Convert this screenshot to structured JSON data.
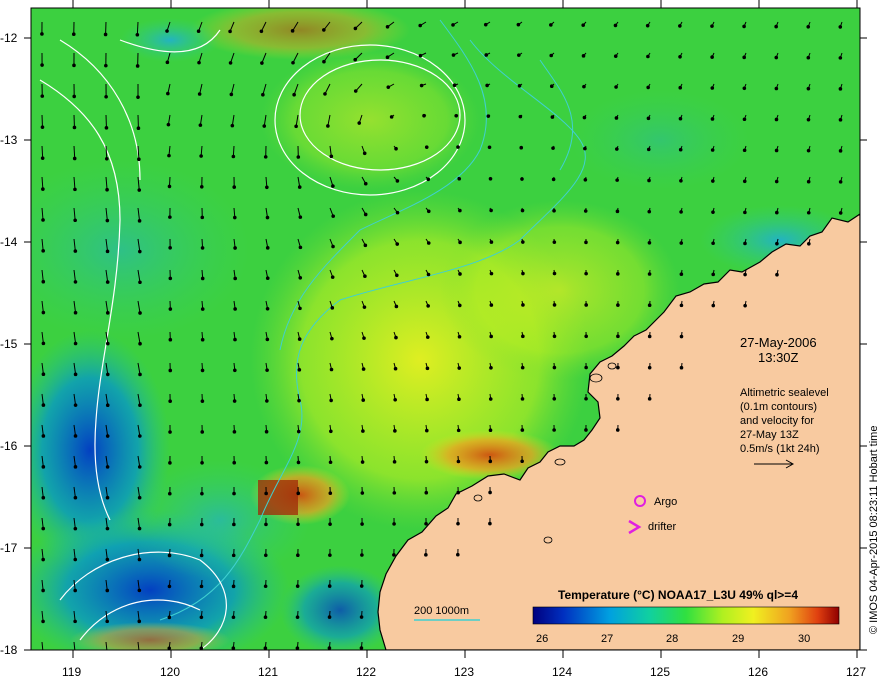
{
  "map": {
    "lon_ticks": [
      "119",
      "120",
      "121",
      "122",
      "123",
      "124",
      "125",
      "126",
      "127"
    ],
    "lat_ticks": [
      "-12",
      "-13",
      "-14",
      "-15",
      "-16",
      "-17",
      "-18"
    ]
  },
  "info": {
    "date": "27-May-2006",
    "time": "13:30Z",
    "altimetry_lines": [
      "Altimetric sealevel",
      "(0.1m contours)",
      "and velocity for",
      "27-May 13Z",
      "0.5m/s (1kt 24h)"
    ]
  },
  "legend": {
    "argo": "Argo",
    "drifter": "drifter",
    "argo_color": "#e020e0",
    "drifter_color": "#e020e0"
  },
  "isobath": {
    "label": "200  1000m",
    "color": "#40d0d0"
  },
  "colorbar": {
    "title": "Temperature (°C) NOAA17_L3U 49% ql>=4",
    "ticks": [
      "26",
      "27",
      "28",
      "29",
      "30"
    ],
    "stops": [
      "#00007f",
      "#0030c0",
      "#00a0e0",
      "#10d0a0",
      "#30e040",
      "#b0f020",
      "#f0f020",
      "#f0a020",
      "#e04010",
      "#900000"
    ]
  },
  "credit": "© IMOS 04-Apr-2015 08:23:11 Hobart time",
  "colors": {
    "land": "#f8caa0",
    "coast": "#000000",
    "contour": "#ffffff"
  }
}
